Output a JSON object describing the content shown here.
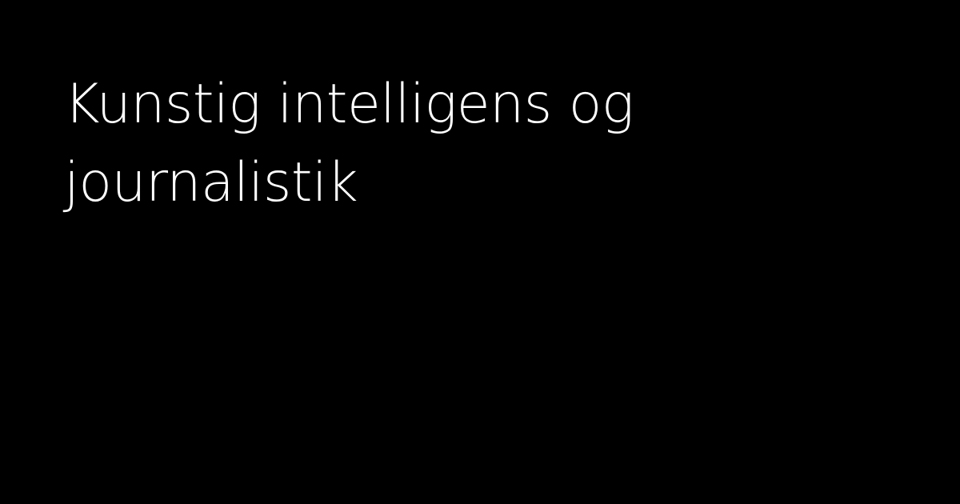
{
  "card": {
    "background": "#000000",
    "text_color": "#ffffff",
    "title_lines": [
      "Kunstig intelligens og",
      "journalistik"
    ]
  }
}
